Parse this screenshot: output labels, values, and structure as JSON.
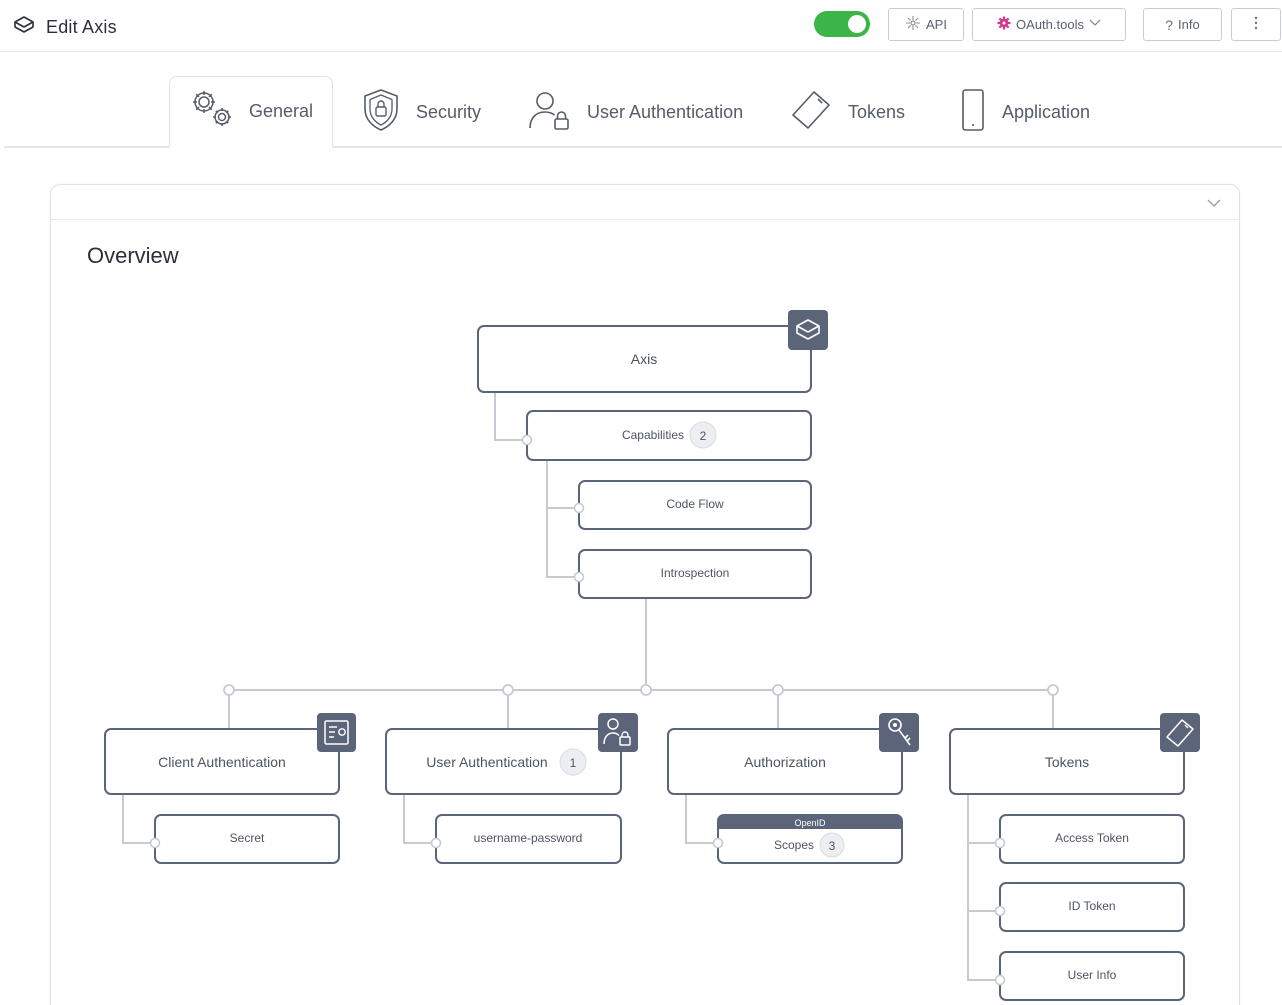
{
  "header": {
    "title": "Edit Axis",
    "toggle_on": true,
    "api_label": "API",
    "oauth_label": "OAuth.tools",
    "info_label": "Info"
  },
  "tabs": [
    {
      "label": "General",
      "active": true
    },
    {
      "label": "Security",
      "active": false
    },
    {
      "label": "User Authentication",
      "active": false
    },
    {
      "label": "Tokens",
      "active": false
    },
    {
      "label": "Application",
      "active": false
    }
  ],
  "overview": {
    "title": "Overview"
  },
  "diagram": {
    "root": "Axis",
    "capabilities": {
      "label": "Capabilities",
      "count": "2",
      "items": [
        "Code Flow",
        "Introspection"
      ]
    },
    "groups": [
      {
        "label": "Client Authentication",
        "icon": "client-auth-icon",
        "children": [
          {
            "label": "Secret"
          }
        ]
      },
      {
        "label": "User Authentication",
        "count": "1",
        "icon": "user-lock-icon",
        "children": [
          {
            "label": "username-password"
          }
        ]
      },
      {
        "label": "Authorization",
        "icon": "key-icon",
        "children": [
          {
            "label": "Scopes",
            "count": "3",
            "tag": "OpenID"
          }
        ]
      },
      {
        "label": "Tokens",
        "icon": "token-icon",
        "children": [
          {
            "label": "Access Token"
          },
          {
            "label": "ID Token"
          },
          {
            "label": "User Info"
          }
        ]
      }
    ]
  },
  "colors": {
    "accent_green": "#3bb54a",
    "node_border": "#5b6478",
    "icon_badge": "#5b6478",
    "connector": "#c6cad2",
    "oauth_pink": "#d6338a"
  }
}
